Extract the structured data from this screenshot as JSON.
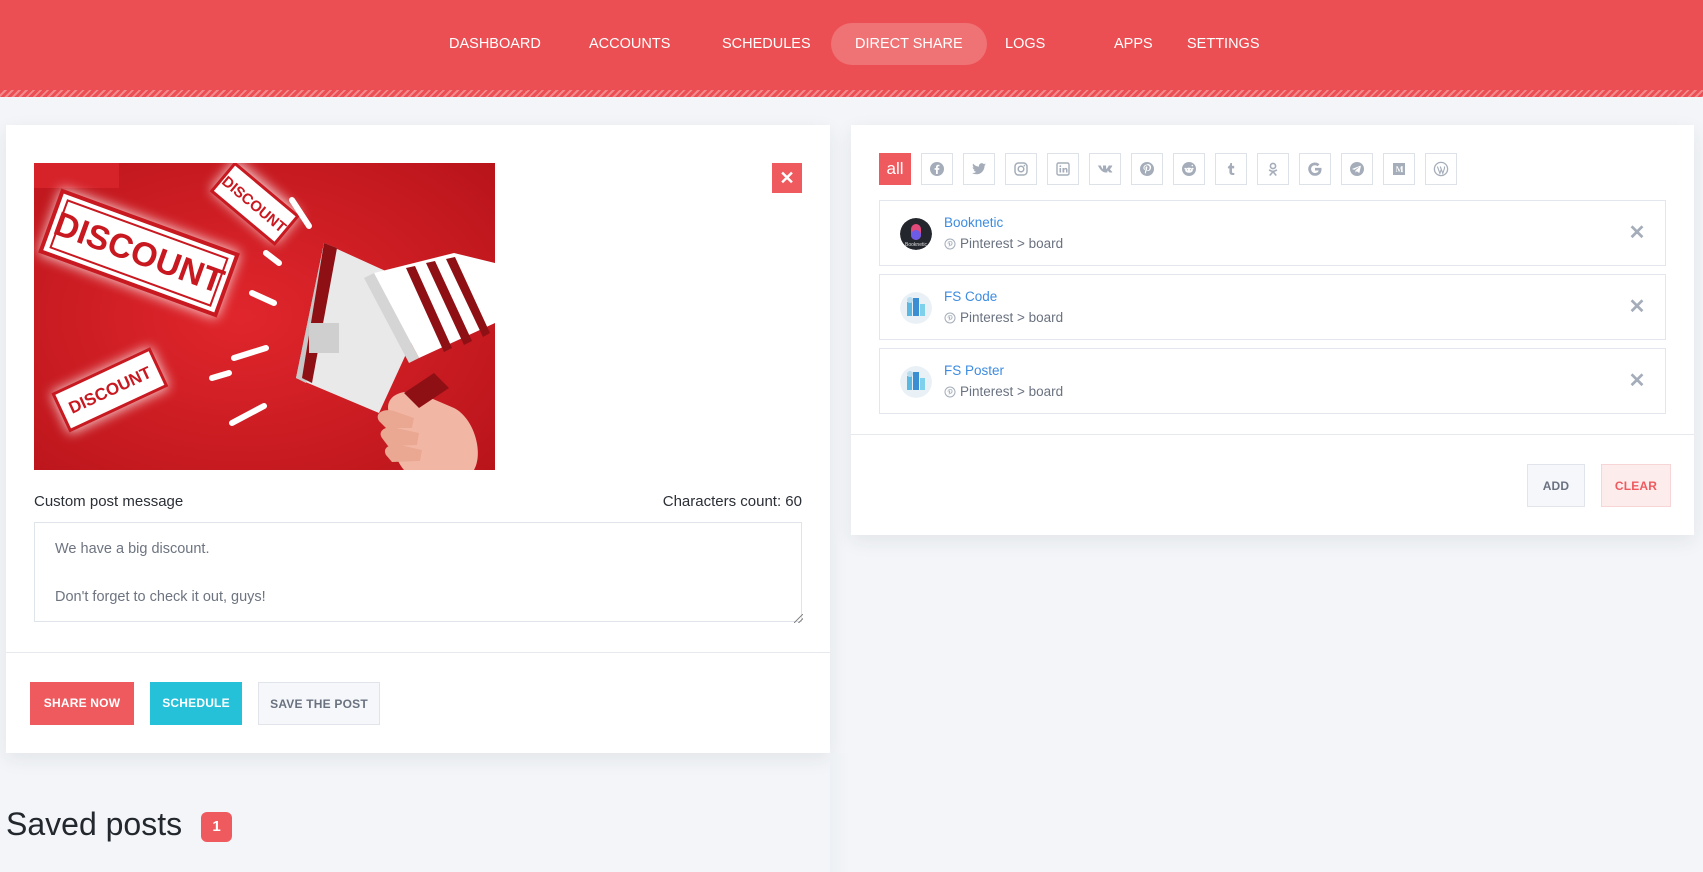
{
  "nav": {
    "items": [
      {
        "label": "DASHBOARD"
      },
      {
        "label": "ACCOUNTS"
      },
      {
        "label": "SCHEDULES"
      },
      {
        "label": "DIRECT SHARE",
        "active": true
      },
      {
        "label": "LOGS"
      },
      {
        "label": "APPS"
      },
      {
        "label": "SETTINGS"
      }
    ]
  },
  "post": {
    "image": {
      "stamps": [
        "DISCOUNT",
        "DISCOUNT",
        "DISCOUNT"
      ]
    },
    "message_label": "Custom post message",
    "chars_label": "Characters count: 60",
    "message_value": "We have a big discount.\n\nDon't forget to check it out, guys!",
    "buttons": {
      "share_now": "SHARE NOW",
      "schedule": "SCHEDULE",
      "save": "SAVE THE POST"
    }
  },
  "saved": {
    "title": "Saved posts",
    "count": "1"
  },
  "filters": {
    "all_label": "all",
    "icons": [
      "facebook-icon",
      "twitter-icon",
      "instagram-icon",
      "linkedin-icon",
      "vk-icon",
      "pinterest-icon",
      "reddit-icon",
      "tumblr-icon",
      "odnoklassniki-icon",
      "google-icon",
      "telegram-icon",
      "medium-icon",
      "wordpress-icon"
    ]
  },
  "accounts": [
    {
      "name": "Booknetic",
      "network": "Pinterest > board",
      "avatar_text": "Booknetic"
    },
    {
      "name": "FS Code",
      "network": "Pinterest > board"
    },
    {
      "name": "FS Poster",
      "network": "Pinterest > board"
    }
  ],
  "right_buttons": {
    "add": "ADD",
    "clear": "CLEAR"
  },
  "colors": {
    "accent": "#ec4f53",
    "schedule": "#25c1d9",
    "link": "#3d8ce0"
  }
}
